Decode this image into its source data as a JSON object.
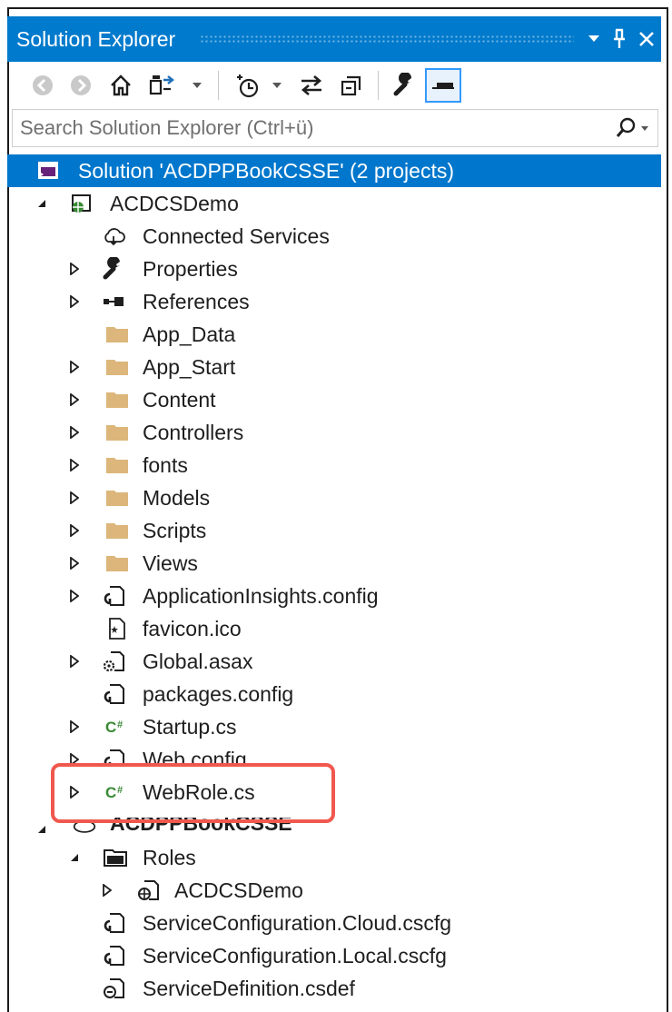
{
  "window": {
    "title": "Solution Explorer",
    "buttons": [
      "dropdown-icon",
      "pin-icon",
      "close-icon"
    ]
  },
  "toolbar": {
    "icons": [
      "back-icon",
      "forward-icon",
      "home-icon",
      "sync-icon",
      "dropdown-icon",
      "history-icon",
      "dropdown-icon",
      "sync-arrows-icon",
      "collapse-all-icon",
      "properties-icon",
      "preview-icon"
    ]
  },
  "search": {
    "placeholder": "Search Solution Explorer (Ctrl+ü)"
  },
  "tree": {
    "solution": "Solution 'ACDPPBookCSSE' (2 projects)",
    "project1": "ACDCSDemo",
    "connected": "Connected Services",
    "properties": "Properties",
    "references": "References",
    "app_data": "App_Data",
    "app_start": "App_Start",
    "content": "Content",
    "controllers": "Controllers",
    "fonts": "fonts",
    "models": "Models",
    "scripts": "Scripts",
    "views": "Views",
    "appinsights": "ApplicationInsights.config",
    "favicon": "favicon.ico",
    "global": "Global.asax",
    "packages": "packages.config",
    "startup": "Startup.cs",
    "webconfig": "Web.config",
    "webrole": "WebRole.cs",
    "project2": "ACDPPBookCSSE",
    "roles": "Roles",
    "role1": "ACDCSDemo",
    "svc_cloud": "ServiceConfiguration.Cloud.cscfg",
    "svc_local": "ServiceConfiguration.Local.cscfg",
    "svc_def": "ServiceDefinition.csdef"
  },
  "colors": {
    "accent": "#007acc",
    "selection": "#0077cc",
    "folder": "#dcb67a",
    "csharp": "#388a34",
    "highlight": "#f0584e"
  }
}
